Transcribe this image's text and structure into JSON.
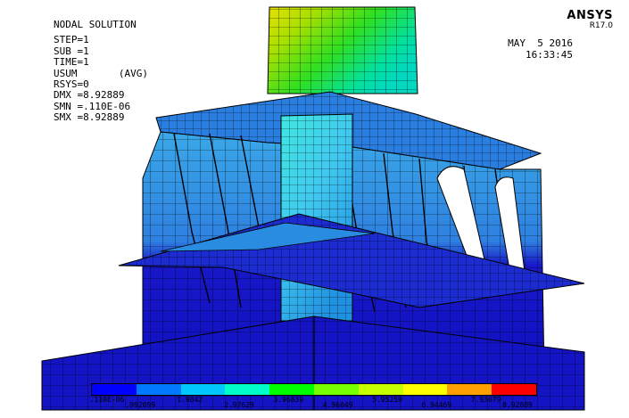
{
  "plot": {
    "title": "NODAL SOLUTION",
    "info_lines": [
      "STEP=1",
      "SUB =1",
      "TIME=1",
      "USUM       (AVG)",
      "RSYS=0",
      "DMX =8.92889",
      "SMN =.110E-06",
      "SMX =8.92889"
    ]
  },
  "brand": {
    "name": "ANSYS",
    "version": "R17.0"
  },
  "datetime": {
    "date": "MAY  5 2016",
    "time": "16:33:45"
  },
  "legend": {
    "colors": [
      "#0000ff",
      "#0078ff",
      "#00c8ff",
      "#00ffc8",
      "#00ff00",
      "#78ff00",
      "#c8ff00",
      "#ffff00",
      "#ffa000",
      "#ff0000"
    ],
    "labels": [
      ".110E-06",
      ".992099",
      "1.9842",
      "2.97629",
      "3.96839",
      "4.96049",
      "5.95259",
      "6.94469",
      "7.93679",
      "8.92889"
    ]
  },
  "colors": {
    "background": "#ffffff",
    "mesh_lines": "#000000",
    "low_displacement": "#1515c8",
    "mid_displacement": "#3aa0e0",
    "column_top": "#d0e000"
  }
}
